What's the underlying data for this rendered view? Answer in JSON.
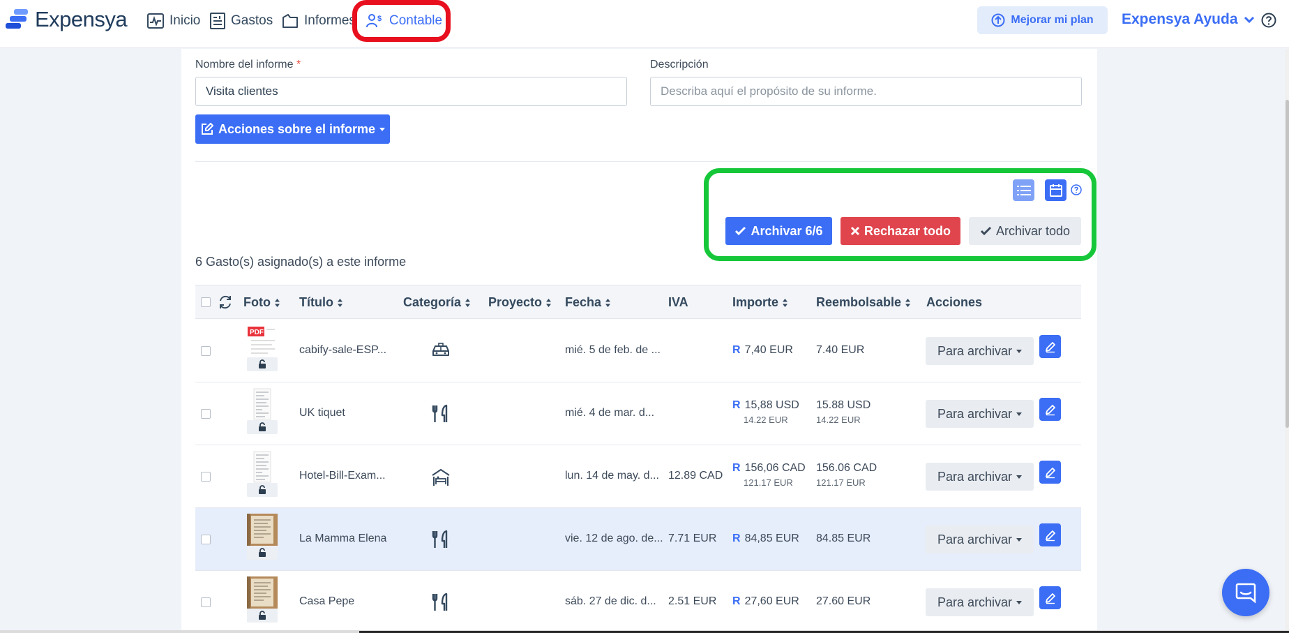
{
  "header": {
    "brand": "Expensya",
    "nav": [
      {
        "label": "Inicio",
        "icon": "activity-icon"
      },
      {
        "label": "Gastos",
        "icon": "receipt-icon"
      },
      {
        "label": "Informes",
        "icon": "folder-icon"
      },
      {
        "label": "Contable",
        "icon": "accountant-icon"
      }
    ],
    "upgrade_label": "Mejorar mi plan",
    "help_menu_label": "Expensya Ayuda"
  },
  "form": {
    "name_label": "Nombre del informe",
    "required_mark": "*",
    "name_value": "Visita clientes",
    "description_label": "Descripción",
    "description_placeholder": "Describa aquí el propósito de su informe.",
    "actions_label": "Acciones sobre el informe"
  },
  "bulk_actions": {
    "archive_selected": "Archivar 6/6",
    "reject_all": "Rechazar todo",
    "archive_all": "Archivar todo"
  },
  "expense_count_text": "6 Gasto(s) asignado(s) a este informe",
  "table": {
    "columns": [
      "Foto",
      "Título",
      "Categoría",
      "Proyecto",
      "Fecha",
      "IVA",
      "Importe",
      "Reembolsable",
      "Acciones"
    ],
    "rows": [
      {
        "title": "cabify-sale-ESP...",
        "category_icon": "taxi-icon",
        "project": "",
        "date": "mié. 5 de feb. de ...",
        "vat": "",
        "amount_prefix": "R",
        "amount": "7,40 EUR",
        "amount_converted": "",
        "reimbursable": "7.40 EUR",
        "reimbursable_converted": "",
        "status": "Para archivar",
        "thumb": "pdf"
      },
      {
        "title": "UK tiquet",
        "category_icon": "restaurant-icon",
        "project": "",
        "date": "mié. 4 de mar. d...",
        "vat": "",
        "amount_prefix": "R",
        "amount": "15,88 USD",
        "amount_converted": "14.22 EUR",
        "reimbursable": "15.88 USD",
        "reimbursable_converted": "14.22 EUR",
        "status": "Para archivar",
        "thumb": "receipt"
      },
      {
        "title": "Hotel-Bill-Exam...",
        "category_icon": "hotel-icon",
        "project": "",
        "date": "lun. 14 de may. d...",
        "vat": "12.89 CAD",
        "amount_prefix": "R",
        "amount": "156,06 CAD",
        "amount_converted": "121.17 EUR",
        "reimbursable": "156.06 CAD",
        "reimbursable_converted": "121.17 EUR",
        "status": "Para archivar",
        "thumb": "receipt"
      },
      {
        "title": "La Mamma Elena",
        "category_icon": "restaurant-icon",
        "project": "",
        "date": "vie. 12 de ago. de...",
        "vat": "7.71 EUR",
        "amount_prefix": "R",
        "amount": "84,85 EUR",
        "amount_converted": "",
        "reimbursable": "84.85 EUR",
        "reimbursable_converted": "",
        "status": "Para archivar",
        "thumb": "photo"
      },
      {
        "title": "Casa Pepe",
        "category_icon": "restaurant-icon",
        "project": "",
        "date": "sáb. 27 de dic. d...",
        "vat": "2.51 EUR",
        "amount_prefix": "R",
        "amount": "27,60 EUR",
        "amount_converted": "",
        "reimbursable": "27.60 EUR",
        "reimbursable_converted": "",
        "status": "Para archivar",
        "thumb": "photo"
      }
    ]
  },
  "colors": {
    "accent": "#3b6ef5",
    "danger": "#e0454d",
    "highlight_red": "#e8101e",
    "highlight_green": "#17c73a",
    "row_highlight": "#e6edfb"
  }
}
